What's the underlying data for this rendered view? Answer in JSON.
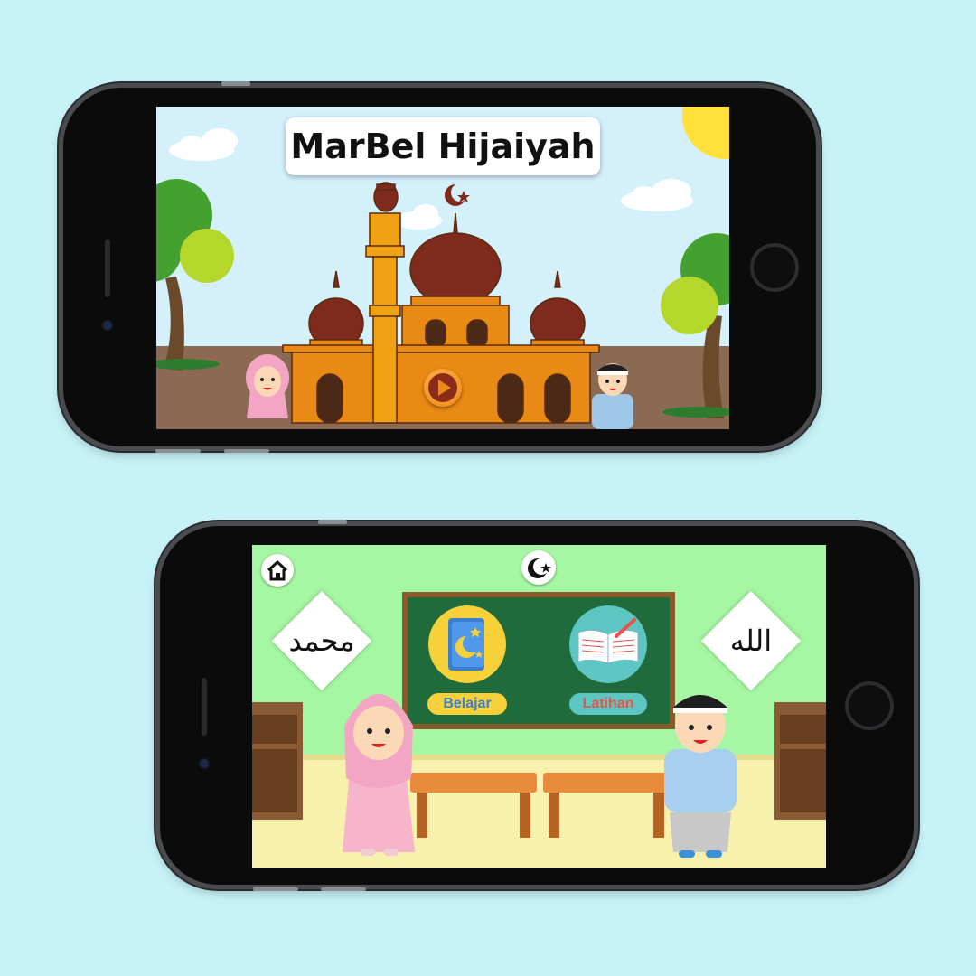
{
  "splash_screen": {
    "title": "MarBel Hijaiyah",
    "play_icon": "play-icon"
  },
  "menu_screen": {
    "home_icon": "home-icon",
    "crescent_icon": "crescent-star-icon",
    "left_calligraphy": "محمد",
    "right_calligraphy": "الله",
    "buttons": [
      {
        "label": "Belajar",
        "icon": "book-moon-icon",
        "color": "#f6d13a",
        "text_color": "#3a7fd1"
      },
      {
        "label": "Latihan",
        "icon": "open-book-pencil-icon",
        "color": "#5ec6c2",
        "text_color": "#e8534b"
      }
    ]
  },
  "colors": {
    "background": "#c6f2f8",
    "mosque_wall": "#e98a14",
    "dome": "#7e2b1d",
    "classroom_wall": "#a6f7a3",
    "chalkboard": "#1f6b3b"
  }
}
